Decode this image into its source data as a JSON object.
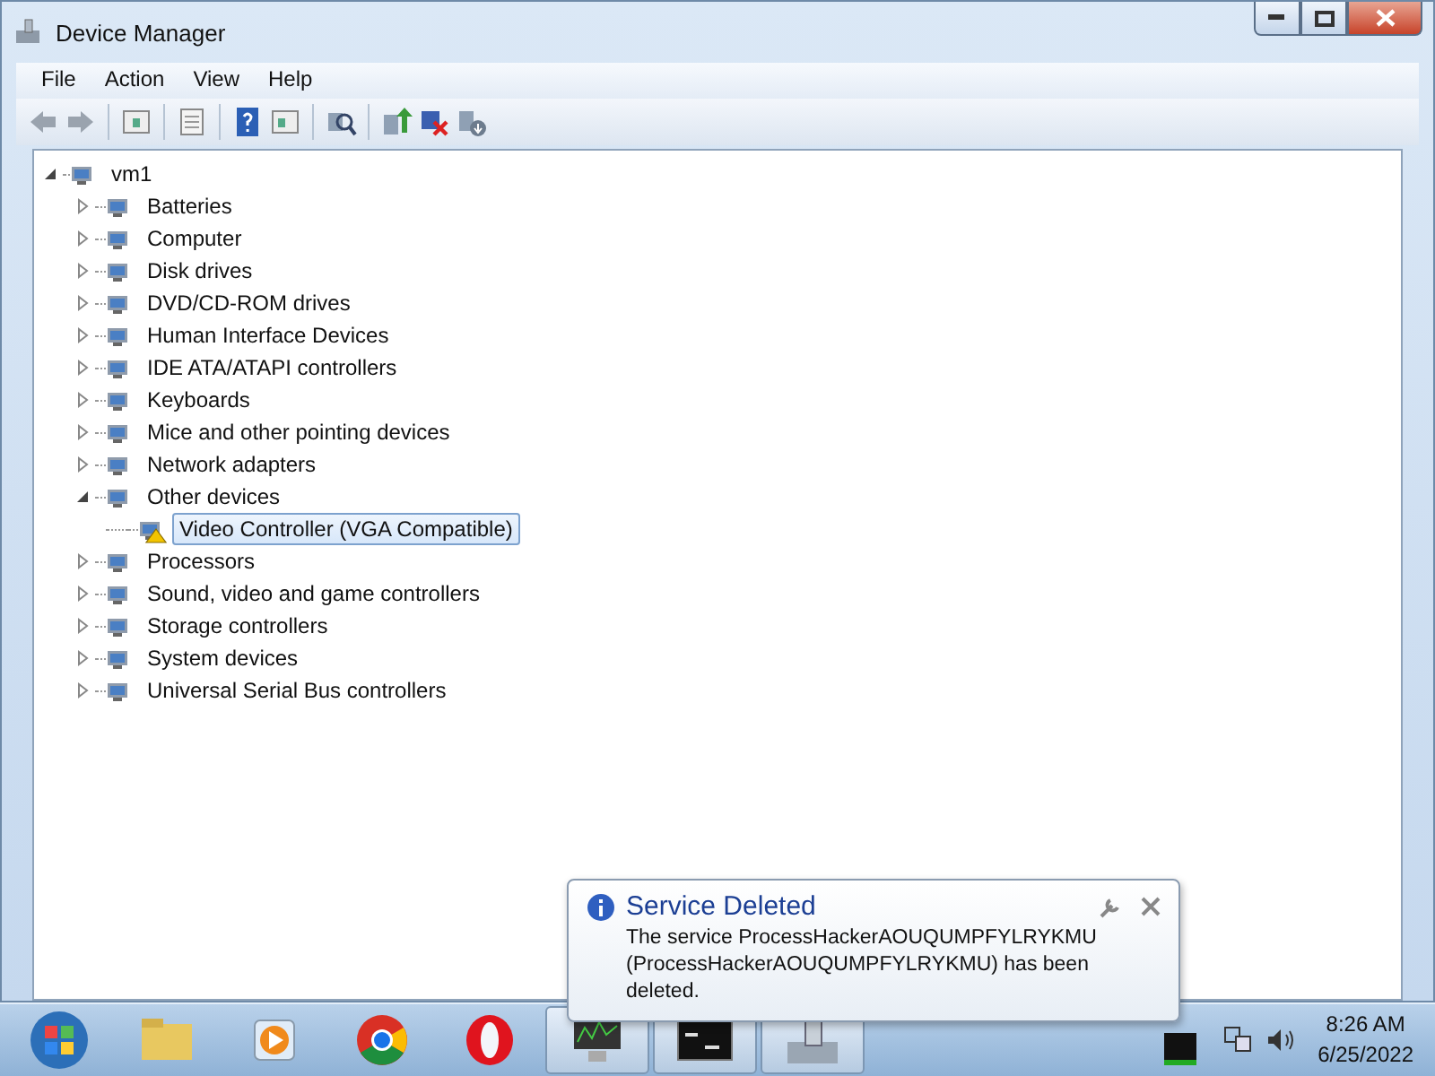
{
  "window": {
    "title": "Device Manager"
  },
  "menu": [
    "File",
    "Action",
    "View",
    "Help"
  ],
  "tree": {
    "label": "vm1",
    "expanded": true,
    "children": [
      {
        "label": "Batteries",
        "expanded": false,
        "selected": false
      },
      {
        "label": "Computer",
        "expanded": false,
        "selected": false
      },
      {
        "label": "Disk drives",
        "expanded": false,
        "selected": false
      },
      {
        "label": "DVD/CD-ROM drives",
        "expanded": false,
        "selected": false
      },
      {
        "label": "Human Interface Devices",
        "expanded": false,
        "selected": false
      },
      {
        "label": "IDE ATA/ATAPI controllers",
        "expanded": false,
        "selected": false
      },
      {
        "label": "Keyboards",
        "expanded": false,
        "selected": false
      },
      {
        "label": "Mice and other pointing devices",
        "expanded": false,
        "selected": false
      },
      {
        "label": "Network adapters",
        "expanded": false,
        "selected": false
      },
      {
        "label": "Other devices",
        "expanded": true,
        "selected": false,
        "children": [
          {
            "label": "Video Controller (VGA Compatible)",
            "selected": true,
            "warning": true
          }
        ]
      },
      {
        "label": "Processors",
        "expanded": false,
        "selected": false
      },
      {
        "label": "Sound, video and game controllers",
        "expanded": false,
        "selected": false
      },
      {
        "label": "Storage controllers",
        "expanded": false,
        "selected": false
      },
      {
        "label": "System devices",
        "expanded": false,
        "selected": false
      },
      {
        "label": "Universal Serial Bus controllers",
        "expanded": false,
        "selected": false
      }
    ]
  },
  "notification": {
    "title": "Service Deleted",
    "message": "The service ProcessHackerAOUQUMPFYLRYKMU (ProcessHackerAOUQUMPFYLRYKMU) has been deleted."
  },
  "clock": {
    "time": "8:26 AM",
    "date": "6/25/2022"
  }
}
